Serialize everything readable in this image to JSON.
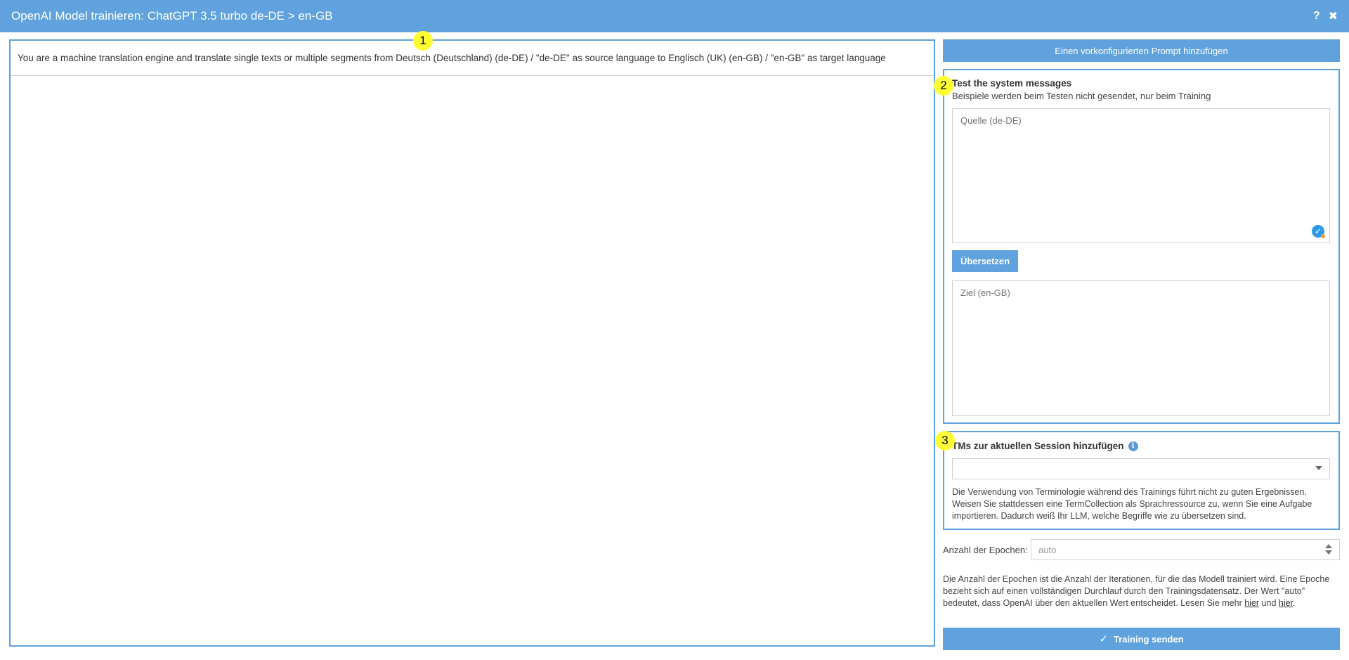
{
  "window": {
    "title": "OpenAI Model trainieren: ChatGPT 3.5 turbo de-DE > en-GB",
    "help_label": "?",
    "close_label": "✖"
  },
  "markers": [
    "1",
    "2",
    "3"
  ],
  "left_panel": {
    "system_message": "You are a machine translation engine and translate single texts or multiple segments from Deutsch (Deutschland) (de-DE) / \"de-DE\" as source language to Englisch (UK) (en-GB) / \"en-GB\" as target language"
  },
  "right_panel": {
    "add_prompt_label": "Einen vorkonfigurierten Prompt hinzufügen",
    "test": {
      "title": "Test the system messages",
      "subtitle": "Beispiele werden beim Testen nicht gesendet, nur beim Training",
      "source_placeholder": "Quelle (de-DE)",
      "translate_label": "Übersetzen",
      "target_placeholder": "Ziel (en-GB)"
    },
    "tms": {
      "title": "TMs zur aktuellen Session hinzufügen",
      "info_glyph": "i",
      "selected_value": "",
      "hint": "Die Verwendung von Terminologie während des Trainings führt nicht zu guten Ergebnissen. Weisen Sie stattdessen eine TermCollection als Sprachressource zu, wenn Sie eine Aufgabe importieren. Dadurch weiß Ihr LLM, welche Begriffe wie zu übersetzen sind."
    },
    "epochs": {
      "label": "Anzahl der Epochen:",
      "placeholder": "auto",
      "description_part1": "Die Anzahl der Epochen ist die Anzahl der Iterationen, für die das Modell trainiert wird. Eine Epoche bezieht sich auf einen vollständigen Durchlauf durch den Trainingsdatensatz. Der Wert \"auto\" bedeutet, dass OpenAI über den aktuellen Wert entscheidet. Lesen Sie mehr ",
      "link1": "hier",
      "description_part2": " und ",
      "link2": "hier",
      "description_part3": "."
    },
    "send_label": "Training senden"
  },
  "colors": {
    "accent": "#5fa2dd",
    "marker": "#ffff33",
    "check_icon": "#2f9be6"
  }
}
